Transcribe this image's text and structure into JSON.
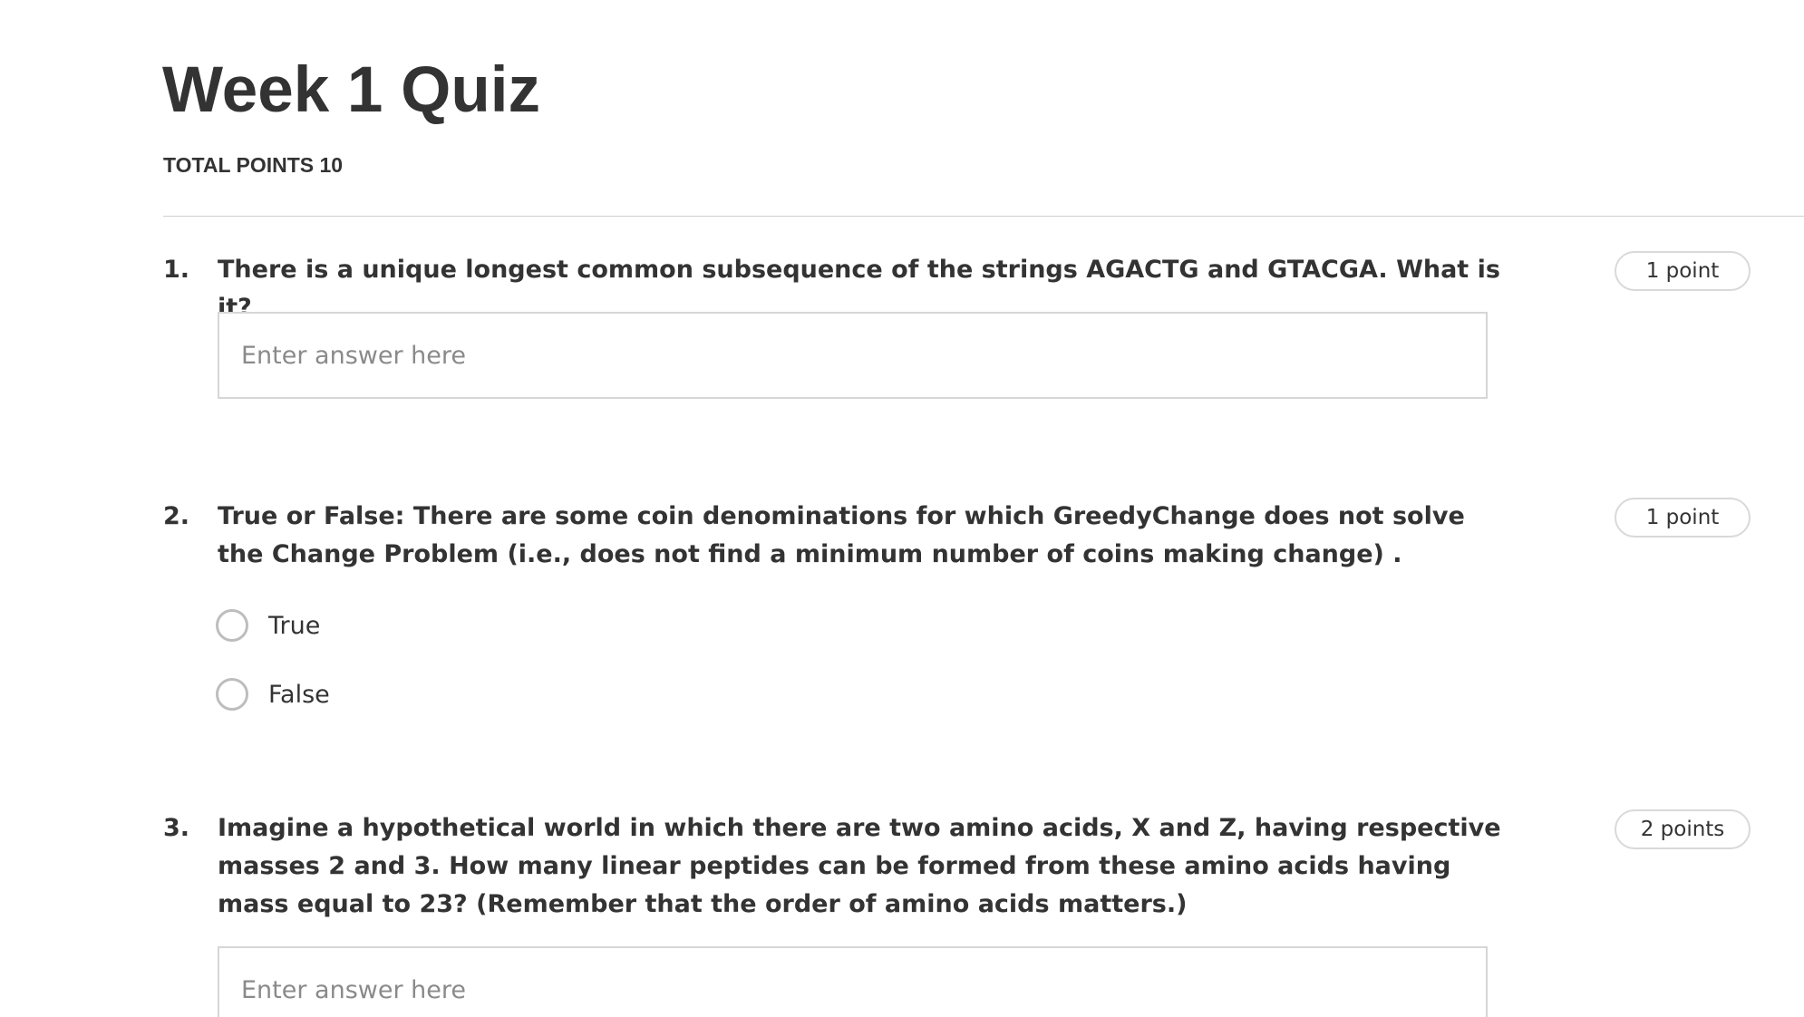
{
  "quiz": {
    "title": "Week 1 Quiz",
    "total_points": "TOTAL POINTS 10"
  },
  "questions": [
    {
      "number": "1.",
      "text": "There is a unique longest common subsequence of the strings AGACTG and GTACGA. What is it?",
      "points": "1 point",
      "type": "text",
      "placeholder": "Enter answer here"
    },
    {
      "number": "2.",
      "text": "True or False: There are some coin denominations for which GreedyChange does not solve the Change Problem (i.e., does not find a minimum number of coins making change) .",
      "points": "1 point",
      "type": "radio",
      "options": [
        "True",
        "False"
      ]
    },
    {
      "number": "3.",
      "text": "Imagine a hypothetical world in which there are two amino acids, X and Z, having respective masses 2 and 3. How many linear peptides can be formed from these amino acids having mass equal to 23? (Remember that the order of amino acids matters.)",
      "points": "2 points",
      "type": "text",
      "placeholder": "Enter answer here"
    }
  ]
}
